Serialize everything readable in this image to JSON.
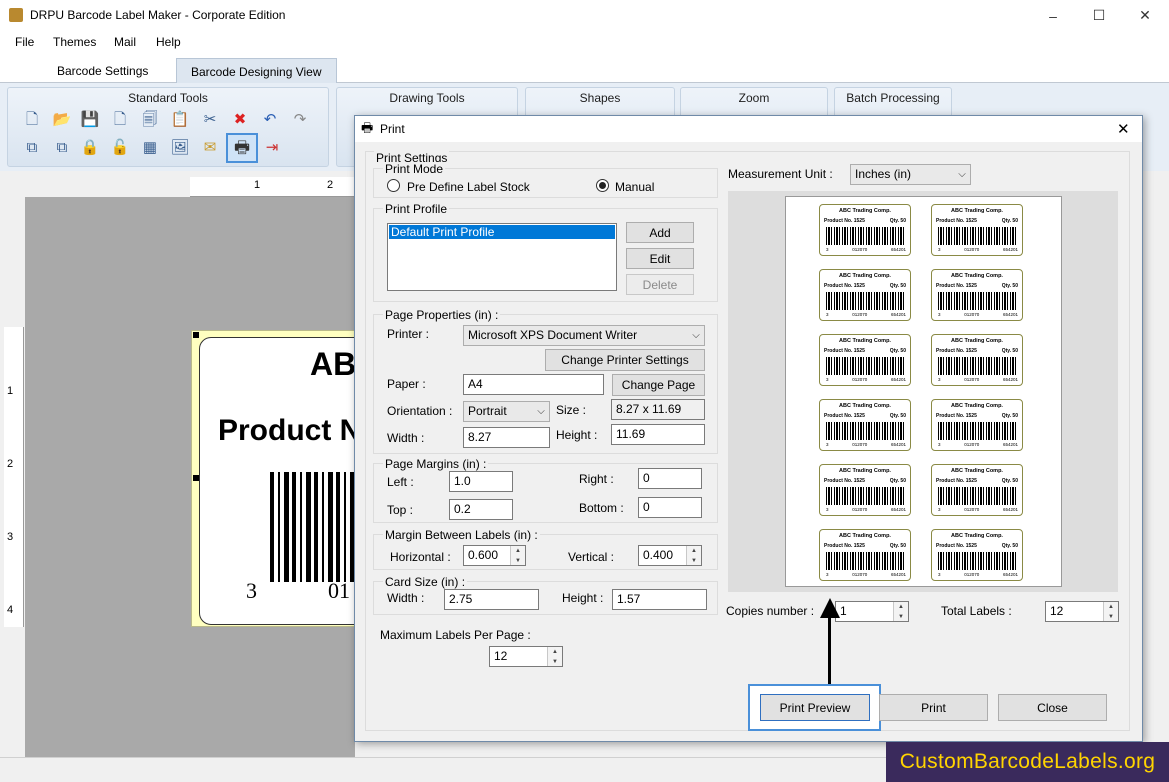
{
  "app": {
    "title": "DRPU Barcode Label Maker - Corporate Edition",
    "minimize": "–",
    "maximize": "☐",
    "close": "✕"
  },
  "menu": {
    "items": [
      "File",
      "Themes",
      "Mail",
      "Help"
    ]
  },
  "tabs": [
    {
      "label": "Barcode Settings",
      "active": false
    },
    {
      "label": "Barcode Designing View",
      "active": true
    }
  ],
  "ribbon": {
    "standard_tools": "Standard Tools",
    "drawing_tools": "Drawing Tools",
    "shapes": "Shapes",
    "zoom": "Zoom",
    "batch_processing": "Batch Processing"
  },
  "ruler": {
    "top": [
      "1",
      "2"
    ],
    "left": [
      "1",
      "2",
      "3",
      "4"
    ]
  },
  "canvas_label": {
    "title": "AB",
    "product": "Product N",
    "digits_left": "3",
    "digits_mid": "01"
  },
  "dialog": {
    "title": "Print",
    "close": "✕",
    "print_settings": "Print Settings",
    "print_mode": {
      "title": "Print Mode",
      "option_predefine": "Pre Define Label Stock",
      "option_manual": "Manual",
      "selected": "Manual"
    },
    "print_profile": {
      "title": "Print Profile",
      "items": [
        "Default Print Profile"
      ],
      "add": "Add",
      "edit": "Edit",
      "delete": "Delete"
    },
    "page_properties": {
      "title": "Page Properties (in) :",
      "printer_label": "Printer :",
      "printer_value": "Microsoft XPS Document Writer",
      "change_printer": "Change Printer Settings",
      "paper_label": "Paper :",
      "paper_value": "A4",
      "change_page": "Change Page",
      "orientation_label": "Orientation :",
      "orientation_value": "Portrait",
      "size_label": "Size :",
      "size_value": "8.27 x 11.69",
      "width_label": "Width :",
      "width_value": "8.27",
      "height_label": "Height :",
      "height_value": "11.69"
    },
    "page_margins": {
      "title": "Page Margins (in) :",
      "left_label": "Left :",
      "left_value": "1.0",
      "right_label": "Right :",
      "right_value": "0",
      "top_label": "Top :",
      "top_value": "0.2",
      "bottom_label": "Bottom :",
      "bottom_value": "0"
    },
    "margin_between": {
      "title": "Margin Between Labels (in) :",
      "horizontal_label": "Horizontal :",
      "horizontal_value": "0.600",
      "vertical_label": "Vertical :",
      "vertical_value": "0.400"
    },
    "card_size": {
      "title": "Card Size (in) :",
      "width_label": "Width :",
      "width_value": "2.75",
      "height_label": "Height :",
      "height_value": "1.57"
    },
    "max_labels": {
      "title": "Maximum Labels Per Page :",
      "value": "12"
    },
    "measurement": {
      "label": "Measurement Unit :",
      "value": "Inches (in)"
    },
    "preview_label": {
      "company": "ABC Trading Comp.",
      "product": "Product No. 1525",
      "qty": "Qty. 50",
      "d1": "3",
      "d2": "012070",
      "d3": "654201"
    },
    "copies_label": "Copies number :",
    "copies_value": "1",
    "total_label": "Total Labels :",
    "total_value": "12",
    "print_preview": "Print Preview",
    "print": "Print",
    "close_btn": "Close"
  },
  "watermark": "CustomBarcodeLabels.org",
  "colors": {
    "selection": "#0078d7",
    "highlight_border": "#4a90d9",
    "watermark_bg": "#3a2a5c",
    "watermark_text": "#ffd400"
  }
}
